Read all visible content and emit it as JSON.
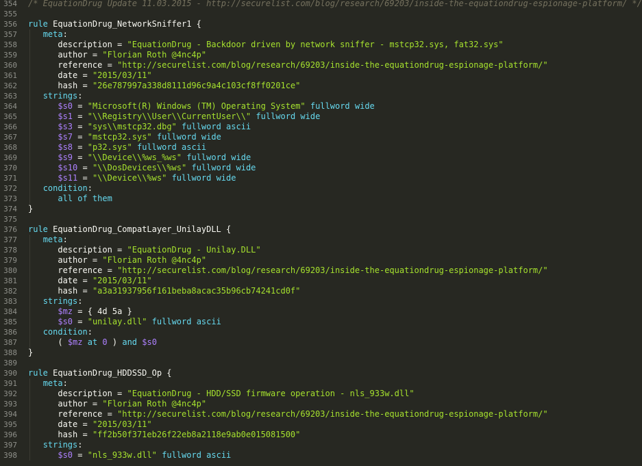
{
  "colors": {
    "background": "#272822",
    "keyword": "#66d9ef",
    "string": "#a6e22e",
    "variable": "#ae81ff",
    "comment": "#75715e",
    "plain": "#f8f8f2",
    "line_number": "#8f908a"
  },
  "lines": [
    {
      "n": "354",
      "ind": 0,
      "tokens": [
        {
          "t": "cm",
          "v": "/* EquationDrug Update 11.03.2015 - http://securelist.com/blog/research/69203/inside-the-equationdrug-espionage-platform/ */"
        }
      ]
    },
    {
      "n": "355",
      "ind": 0,
      "tokens": []
    },
    {
      "n": "356",
      "ind": 0,
      "tokens": [
        {
          "t": "kw",
          "v": "rule"
        },
        {
          "t": "pl",
          "v": " EquationDrug_NetworkSniffer1 {"
        }
      ]
    },
    {
      "n": "357",
      "ind": 1,
      "tokens": [
        {
          "t": "kw",
          "v": "meta"
        },
        {
          "t": "pl",
          "v": ":"
        }
      ]
    },
    {
      "n": "358",
      "ind": 2,
      "tokens": [
        {
          "t": "pl",
          "v": "description = "
        },
        {
          "t": "str",
          "v": "\"EquationDrug - Backdoor driven by network sniffer - mstcp32.sys, fat32.sys\""
        }
      ]
    },
    {
      "n": "359",
      "ind": 2,
      "tokens": [
        {
          "t": "pl",
          "v": "author = "
        },
        {
          "t": "str",
          "v": "\"Florian Roth @4nc4p\""
        }
      ]
    },
    {
      "n": "360",
      "ind": 2,
      "tokens": [
        {
          "t": "pl",
          "v": "reference = "
        },
        {
          "t": "str",
          "v": "\"http://securelist.com/blog/research/69203/inside-the-equationdrug-espionage-platform/\""
        }
      ]
    },
    {
      "n": "361",
      "ind": 2,
      "tokens": [
        {
          "t": "pl",
          "v": "date = "
        },
        {
          "t": "str",
          "v": "\"2015/03/11\""
        }
      ]
    },
    {
      "n": "362",
      "ind": 2,
      "tokens": [
        {
          "t": "pl",
          "v": "hash = "
        },
        {
          "t": "str",
          "v": "\"26e787997a338d8111d96c9a4c103cf8ff0201ce\""
        }
      ]
    },
    {
      "n": "363",
      "ind": 1,
      "tokens": [
        {
          "t": "kw",
          "v": "strings"
        },
        {
          "t": "pl",
          "v": ":"
        }
      ]
    },
    {
      "n": "364",
      "ind": 2,
      "tokens": [
        {
          "t": "var",
          "v": "$s0"
        },
        {
          "t": "pl",
          "v": " = "
        },
        {
          "t": "str",
          "v": "\"Microsoft(R) Windows (TM) Operating System\""
        },
        {
          "t": "pl",
          "v": " "
        },
        {
          "t": "kw",
          "v": "fullword wide"
        }
      ]
    },
    {
      "n": "365",
      "ind": 2,
      "tokens": [
        {
          "t": "var",
          "v": "$s1"
        },
        {
          "t": "pl",
          "v": " = "
        },
        {
          "t": "str",
          "v": "\"\\\\Registry\\\\User\\\\CurrentUser\\\\\""
        },
        {
          "t": "pl",
          "v": " "
        },
        {
          "t": "kw",
          "v": "fullword wide"
        }
      ]
    },
    {
      "n": "366",
      "ind": 2,
      "tokens": [
        {
          "t": "var",
          "v": "$s3"
        },
        {
          "t": "pl",
          "v": " = "
        },
        {
          "t": "str",
          "v": "\"sys\\\\mstcp32.dbg\""
        },
        {
          "t": "pl",
          "v": " "
        },
        {
          "t": "kw",
          "v": "fullword ascii"
        }
      ]
    },
    {
      "n": "367",
      "ind": 2,
      "tokens": [
        {
          "t": "var",
          "v": "$s7"
        },
        {
          "t": "pl",
          "v": " = "
        },
        {
          "t": "str",
          "v": "\"mstcp32.sys\""
        },
        {
          "t": "pl",
          "v": " "
        },
        {
          "t": "kw",
          "v": "fullword wide"
        }
      ]
    },
    {
      "n": "368",
      "ind": 2,
      "tokens": [
        {
          "t": "var",
          "v": "$s8"
        },
        {
          "t": "pl",
          "v": " = "
        },
        {
          "t": "str",
          "v": "\"p32.sys\""
        },
        {
          "t": "pl",
          "v": " "
        },
        {
          "t": "kw",
          "v": "fullword ascii"
        }
      ]
    },
    {
      "n": "369",
      "ind": 2,
      "tokens": [
        {
          "t": "var",
          "v": "$s9"
        },
        {
          "t": "pl",
          "v": " = "
        },
        {
          "t": "str",
          "v": "\"\\\\Device\\\\%ws_%ws\""
        },
        {
          "t": "pl",
          "v": " "
        },
        {
          "t": "kw",
          "v": "fullword wide"
        }
      ]
    },
    {
      "n": "370",
      "ind": 2,
      "tokens": [
        {
          "t": "var",
          "v": "$s10"
        },
        {
          "t": "pl",
          "v": " = "
        },
        {
          "t": "str",
          "v": "\"\\\\DosDevices\\\\%ws\""
        },
        {
          "t": "pl",
          "v": " "
        },
        {
          "t": "kw",
          "v": "fullword wide"
        }
      ]
    },
    {
      "n": "371",
      "ind": 2,
      "tokens": [
        {
          "t": "var",
          "v": "$s11"
        },
        {
          "t": "pl",
          "v": " = "
        },
        {
          "t": "str",
          "v": "\"\\\\Device\\\\%ws\""
        },
        {
          "t": "pl",
          "v": " "
        },
        {
          "t": "kw",
          "v": "fullword wide"
        }
      ]
    },
    {
      "n": "372",
      "ind": 1,
      "tokens": [
        {
          "t": "kw",
          "v": "condition"
        },
        {
          "t": "pl",
          "v": ":"
        }
      ]
    },
    {
      "n": "373",
      "ind": 2,
      "tokens": [
        {
          "t": "kw",
          "v": "all of them"
        }
      ]
    },
    {
      "n": "374",
      "ind": 0,
      "tokens": [
        {
          "t": "pl",
          "v": "}"
        }
      ]
    },
    {
      "n": "375",
      "ind": 0,
      "tokens": []
    },
    {
      "n": "376",
      "ind": 0,
      "tokens": [
        {
          "t": "kw",
          "v": "rule"
        },
        {
          "t": "pl",
          "v": " EquationDrug_CompatLayer_UnilayDLL {"
        }
      ]
    },
    {
      "n": "377",
      "ind": 1,
      "tokens": [
        {
          "t": "kw",
          "v": "meta"
        },
        {
          "t": "pl",
          "v": ":"
        }
      ]
    },
    {
      "n": "378",
      "ind": 2,
      "tokens": [
        {
          "t": "pl",
          "v": "description = "
        },
        {
          "t": "str",
          "v": "\"EquationDrug - Unilay.DLL\""
        }
      ]
    },
    {
      "n": "379",
      "ind": 2,
      "tokens": [
        {
          "t": "pl",
          "v": "author = "
        },
        {
          "t": "str",
          "v": "\"Florian Roth @4nc4p\""
        }
      ]
    },
    {
      "n": "380",
      "ind": 2,
      "tokens": [
        {
          "t": "pl",
          "v": "reference = "
        },
        {
          "t": "str",
          "v": "\"http://securelist.com/blog/research/69203/inside-the-equationdrug-espionage-platform/\""
        }
      ]
    },
    {
      "n": "381",
      "ind": 2,
      "tokens": [
        {
          "t": "pl",
          "v": "date = "
        },
        {
          "t": "str",
          "v": "\"2015/03/11\""
        }
      ]
    },
    {
      "n": "382",
      "ind": 2,
      "tokens": [
        {
          "t": "pl",
          "v": "hash = "
        },
        {
          "t": "str",
          "v": "\"a3a31937956f161beba8acac35b96cb74241cd0f\""
        }
      ]
    },
    {
      "n": "383",
      "ind": 1,
      "tokens": [
        {
          "t": "kw",
          "v": "strings"
        },
        {
          "t": "pl",
          "v": ":"
        }
      ]
    },
    {
      "n": "384",
      "ind": 2,
      "tokens": [
        {
          "t": "var",
          "v": "$mz"
        },
        {
          "t": "pl",
          "v": " = { "
        },
        {
          "t": "pl",
          "v": "4d 5a"
        },
        {
          "t": "pl",
          "v": " }"
        }
      ]
    },
    {
      "n": "385",
      "ind": 2,
      "tokens": [
        {
          "t": "var",
          "v": "$s0"
        },
        {
          "t": "pl",
          "v": " = "
        },
        {
          "t": "str",
          "v": "\"unilay.dll\""
        },
        {
          "t": "pl",
          "v": " "
        },
        {
          "t": "kw",
          "v": "fullword ascii"
        }
      ]
    },
    {
      "n": "386",
      "ind": 1,
      "tokens": [
        {
          "t": "kw",
          "v": "condition"
        },
        {
          "t": "pl",
          "v": ":"
        }
      ]
    },
    {
      "n": "387",
      "ind": 2,
      "tokens": [
        {
          "t": "pl",
          "v": "( "
        },
        {
          "t": "var",
          "v": "$mz"
        },
        {
          "t": "pl",
          "v": " "
        },
        {
          "t": "kw",
          "v": "at"
        },
        {
          "t": "pl",
          "v": " "
        },
        {
          "t": "var",
          "v": "0"
        },
        {
          "t": "pl",
          "v": " ) "
        },
        {
          "t": "kw",
          "v": "and"
        },
        {
          "t": "pl",
          "v": " "
        },
        {
          "t": "var",
          "v": "$s0"
        }
      ]
    },
    {
      "n": "388",
      "ind": 0,
      "tokens": [
        {
          "t": "pl",
          "v": "}"
        }
      ]
    },
    {
      "n": "389",
      "ind": 0,
      "tokens": []
    },
    {
      "n": "390",
      "ind": 0,
      "tokens": [
        {
          "t": "kw",
          "v": "rule"
        },
        {
          "t": "pl",
          "v": " EquationDrug_HDDSSD_Op {"
        }
      ]
    },
    {
      "n": "391",
      "ind": 1,
      "tokens": [
        {
          "t": "kw",
          "v": "meta"
        },
        {
          "t": "pl",
          "v": ":"
        }
      ]
    },
    {
      "n": "392",
      "ind": 2,
      "tokens": [
        {
          "t": "pl",
          "v": "description = "
        },
        {
          "t": "str",
          "v": "\"EquationDrug - HDD/SSD firmware operation - nls_933w.dll\""
        }
      ]
    },
    {
      "n": "393",
      "ind": 2,
      "tokens": [
        {
          "t": "pl",
          "v": "author = "
        },
        {
          "t": "str",
          "v": "\"Florian Roth @4nc4p\""
        }
      ]
    },
    {
      "n": "394",
      "ind": 2,
      "tokens": [
        {
          "t": "pl",
          "v": "reference = "
        },
        {
          "t": "str",
          "v": "\"http://securelist.com/blog/research/69203/inside-the-equationdrug-espionage-platform/\""
        }
      ]
    },
    {
      "n": "395",
      "ind": 2,
      "tokens": [
        {
          "t": "pl",
          "v": "date = "
        },
        {
          "t": "str",
          "v": "\"2015/03/11\""
        }
      ]
    },
    {
      "n": "396",
      "ind": 2,
      "tokens": [
        {
          "t": "pl",
          "v": "hash = "
        },
        {
          "t": "str",
          "v": "\"ff2b50f371eb26f22eb8a2118e9ab0e015081500\""
        }
      ]
    },
    {
      "n": "397",
      "ind": 1,
      "tokens": [
        {
          "t": "kw",
          "v": "strings"
        },
        {
          "t": "pl",
          "v": ":"
        }
      ]
    },
    {
      "n": "398",
      "ind": 2,
      "tokens": [
        {
          "t": "var",
          "v": "$s0"
        },
        {
          "t": "pl",
          "v": " = "
        },
        {
          "t": "str",
          "v": "\"nls_933w.dll\""
        },
        {
          "t": "pl",
          "v": " "
        },
        {
          "t": "kw",
          "v": "fullword ascii"
        }
      ]
    }
  ]
}
